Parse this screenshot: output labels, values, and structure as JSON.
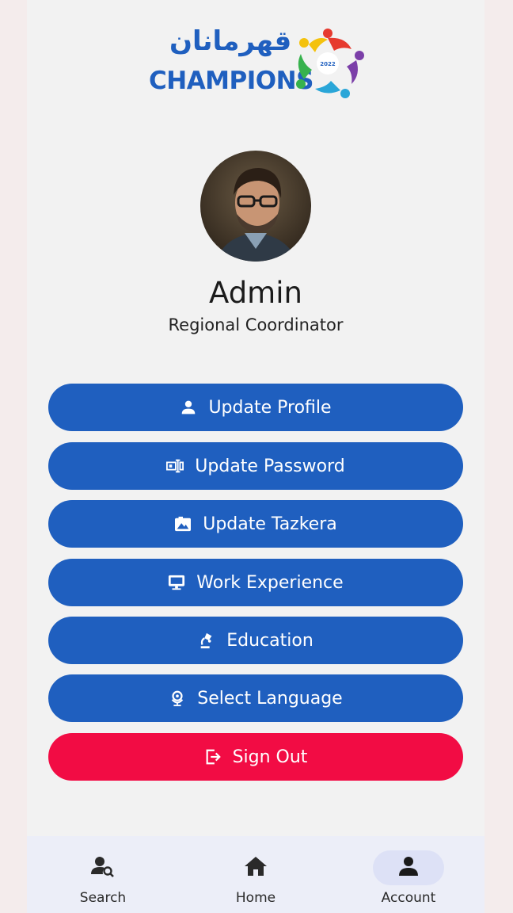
{
  "brand": {
    "arabic": "قهرمانان",
    "name": "CHAMPIONS",
    "year": "2022"
  },
  "profile": {
    "name": "Admin",
    "role": "Regional Coordinator"
  },
  "menu": [
    {
      "label": "Update Profile",
      "icon": "person-icon"
    },
    {
      "label": "Update Password",
      "icon": "password-icon"
    },
    {
      "label": "Update Tazkera",
      "icon": "image-icon"
    },
    {
      "label": "Work Experience",
      "icon": "monitor-icon"
    },
    {
      "label": "Education",
      "icon": "lamp-icon"
    },
    {
      "label": "Select Language",
      "icon": "globe-icon"
    }
  ],
  "signout": {
    "label": "Sign Out",
    "icon": "logout-icon"
  },
  "nav": [
    {
      "label": "Search",
      "icon": "person-search-icon"
    },
    {
      "label": "Home",
      "icon": "home-icon"
    },
    {
      "label": "Account",
      "icon": "account-icon",
      "active": true
    }
  ],
  "colors": {
    "primary": "#1f5fbf",
    "danger": "#f20c44",
    "nav_bg": "#eceef8",
    "active_pill": "#dde1f6"
  }
}
